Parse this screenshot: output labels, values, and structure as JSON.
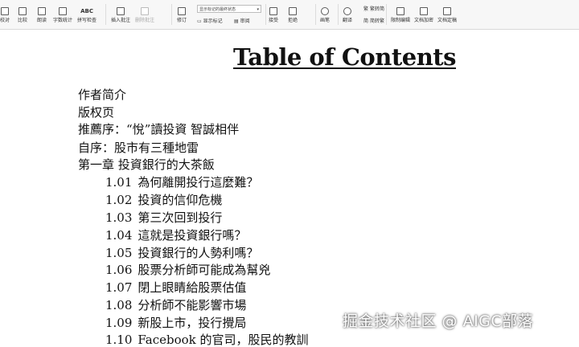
{
  "toolbar": {
    "items": [
      {
        "label": "校对",
        "icon": "proofread-icon"
      },
      {
        "label": "比较",
        "icon": "compare-icon"
      },
      {
        "label": "朗读",
        "icon": "read-aloud-icon"
      },
      {
        "label": "字数统计",
        "icon": "word-count-icon"
      },
      {
        "label": "拼写检查",
        "icon": "spell-check-icon",
        "icon_text": "ABC"
      },
      {
        "label": "插入批注",
        "icon": "insert-comment-icon"
      },
      {
        "label": "删除批注",
        "icon": "delete-comment-icon",
        "disabled": true
      },
      {
        "label": "修订",
        "icon": "track-changes-icon"
      },
      {
        "label": "显示标记",
        "icon": "show-markup-icon"
      },
      {
        "label": "审阅",
        "icon": "reviewing-pane-icon"
      },
      {
        "label": "接受",
        "icon": "accept-icon"
      },
      {
        "label": "拒绝",
        "icon": "reject-icon"
      },
      {
        "label": "画笔",
        "icon": "pen-icon"
      },
      {
        "label": "翻译",
        "icon": "translate-icon"
      },
      {
        "label": "简繁",
        "icon": "convert-icon"
      },
      {
        "label": "限制编辑",
        "icon": "restrict-editing-icon"
      },
      {
        "label": "文档加密",
        "icon": "encrypt-icon"
      },
      {
        "label": "文档定稿",
        "icon": "finalize-icon"
      }
    ],
    "markup_state": "显示标记的最终状态",
    "to_traditional": "繁转简",
    "to_simplified": "简转繁"
  },
  "document": {
    "title": "Table of Contents",
    "entries": [
      {
        "num": "",
        "text": "作者简介"
      },
      {
        "num": "",
        "text": "版权页"
      },
      {
        "num": "",
        "text": "推薦序：“悅”讀投資  智誠相伴"
      },
      {
        "num": "",
        "text": "自序：股市有三種地雷"
      },
      {
        "num": "",
        "text": "第一章  投資銀行的大茶飯"
      },
      {
        "num": "1.01",
        "text": "為何離開投行這麼難？"
      },
      {
        "num": "1.02",
        "text": "投資的信仰危機"
      },
      {
        "num": "1.03",
        "text": "第三次回到投行"
      },
      {
        "num": "1.04",
        "text": "這就是投資銀行嗎？"
      },
      {
        "num": "1.05",
        "text": "投資銀行的人勢利嗎？"
      },
      {
        "num": "1.06",
        "text": "股票分析師可能成為幫兇"
      },
      {
        "num": "1.07",
        "text": "閉上眼睛給股票估值"
      },
      {
        "num": "1.08",
        "text": "分析師不能影響市場"
      },
      {
        "num": "1.09",
        "text": "新股上市，投行攪局"
      },
      {
        "num": "1.10",
        "text": "Facebook 的官司，股民的教訓"
      }
    ]
  },
  "watermark": "掘金技术社区 @ AIGC部落"
}
